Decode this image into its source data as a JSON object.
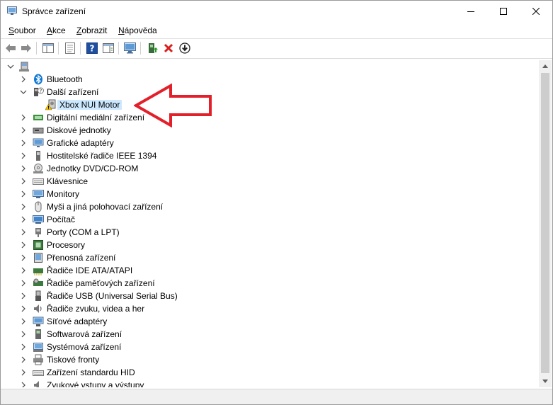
{
  "window": {
    "title": "Správce zařízení"
  },
  "menu": [
    {
      "label": "Soubor",
      "key": "S",
      "rest": "oubor"
    },
    {
      "label": "Akce",
      "key": "A",
      "rest": "kce"
    },
    {
      "label": "Zobrazit",
      "key": "Z",
      "rest": "obrazit"
    },
    {
      "label": "Nápověda",
      "key": "N",
      "rest": "ápověda"
    }
  ],
  "tree": {
    "root_label": "",
    "items": [
      {
        "label": "Bluetooth",
        "icon": "bluetooth-icon",
        "expanded": false
      },
      {
        "label": "Další zařízení",
        "icon": "unknown-device-icon",
        "expanded": true
      },
      {
        "label": "Xbox NUI Motor",
        "icon": "warning-device-icon",
        "child": true,
        "selected": true
      },
      {
        "label": "Digitální mediální zařízení",
        "icon": "media-device-icon",
        "expanded": false
      },
      {
        "label": "Diskové jednotky",
        "icon": "disk-drive-icon",
        "expanded": false
      },
      {
        "label": "Grafické adaptéry",
        "icon": "display-adapter-icon",
        "expanded": false
      },
      {
        "label": "Hostitelské řadiče IEEE 1394",
        "icon": "ieee1394-icon",
        "expanded": false
      },
      {
        "label": "Jednotky DVD/CD-ROM",
        "icon": "dvd-drive-icon",
        "expanded": false
      },
      {
        "label": "Klávesnice",
        "icon": "keyboard-icon",
        "expanded": false
      },
      {
        "label": "Monitory",
        "icon": "monitor-icon",
        "expanded": false
      },
      {
        "label": "Myši a jiná polohovací zařízení",
        "icon": "mouse-icon",
        "expanded": false
      },
      {
        "label": "Počítač",
        "icon": "computer-icon",
        "expanded": false
      },
      {
        "label": "Porty (COM a LPT)",
        "icon": "port-icon",
        "expanded": false
      },
      {
        "label": "Procesory",
        "icon": "processor-icon",
        "expanded": false
      },
      {
        "label": "Přenosná zařízení",
        "icon": "portable-device-icon",
        "expanded": false
      },
      {
        "label": "Řadiče IDE ATA/ATAPI",
        "icon": "ide-controller-icon",
        "expanded": false
      },
      {
        "label": "Řadiče paměťových zařízení",
        "icon": "storage-controller-icon",
        "expanded": false
      },
      {
        "label": "Řadiče USB (Universal Serial Bus)",
        "icon": "usb-icon",
        "expanded": false
      },
      {
        "label": "Řadiče zvuku, videa a her",
        "icon": "sound-icon",
        "expanded": false
      },
      {
        "label": "Síťové adaptéry",
        "icon": "network-adapter-icon",
        "expanded": false
      },
      {
        "label": "Softwarová zařízení",
        "icon": "software-device-icon",
        "expanded": false
      },
      {
        "label": "Systémová zařízení",
        "icon": "system-device-icon",
        "expanded": false
      },
      {
        "label": "Tiskové fronty",
        "icon": "print-queue-icon",
        "expanded": false
      },
      {
        "label": "Zařízení standardu HID",
        "icon": "hid-icon",
        "expanded": false
      },
      {
        "label": "Zvukové vstupy a výstupy",
        "icon": "audio-io-icon",
        "expanded": false
      }
    ]
  },
  "colors": {
    "selection": "#cce8ff",
    "annotation_arrow": "#e3202a",
    "bluetooth": "#1178d4"
  }
}
